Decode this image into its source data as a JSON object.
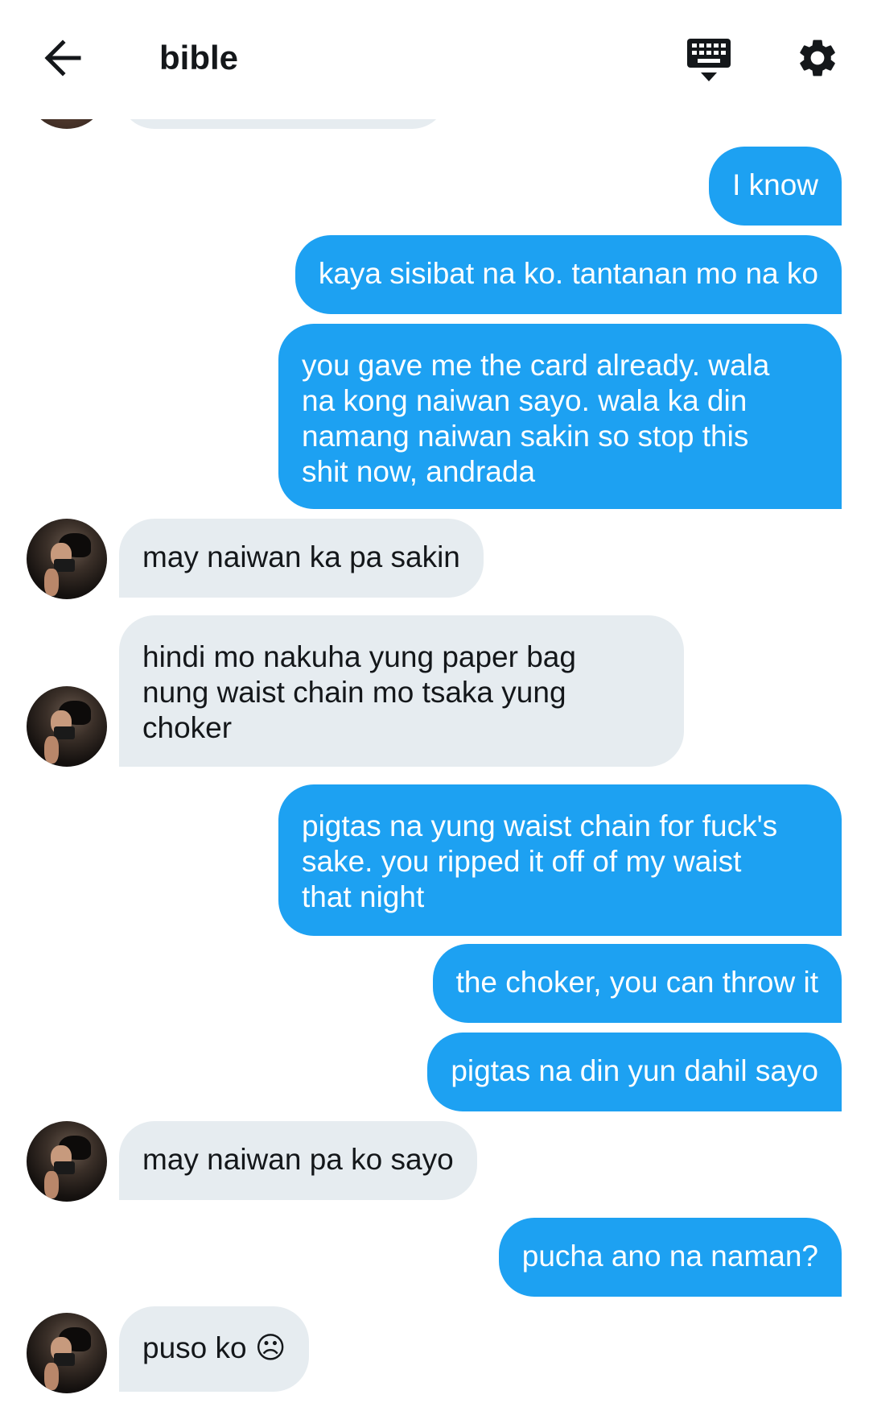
{
  "header": {
    "title": "bible",
    "back_icon": "arrow-left-icon",
    "keyboard_icon": "keyboard-hide-icon",
    "settings_icon": "gear-icon"
  },
  "colors": {
    "outgoing_bubble": "#1da1f2",
    "incoming_bubble": "#e6ecf0",
    "outgoing_text": "#ffffff",
    "incoming_text": "#14171a"
  },
  "messages": [
    {
      "sender": "me",
      "text": "I know"
    },
    {
      "sender": "me",
      "text": "kaya sisibat na ko. tantanan mo na ko"
    },
    {
      "sender": "me",
      "lines": [
        "you gave me the card already. wala",
        "na kong naiwan sayo. wala ka din",
        "namang naiwan sakin so stop this",
        "shit now, andrada"
      ]
    },
    {
      "sender": "them",
      "text": "may naiwan ka pa sakin"
    },
    {
      "sender": "them",
      "lines": [
        "hindi mo nakuha yung paper bag",
        "nung waist chain mo tsaka yung",
        "choker"
      ]
    },
    {
      "sender": "me",
      "lines": [
        "pigtas na yung waist chain for fuck's",
        "sake. you ripped it off of my waist",
        "that night"
      ]
    },
    {
      "sender": "me",
      "text": "the choker, you can throw it"
    },
    {
      "sender": "me",
      "text": "pigtas na din yun dahil sayo"
    },
    {
      "sender": "them",
      "text": "may naiwan pa ko sayo"
    },
    {
      "sender": "me",
      "text": "pucha ano na naman?"
    },
    {
      "sender": "them",
      "text": "puso ko ☹"
    }
  ]
}
